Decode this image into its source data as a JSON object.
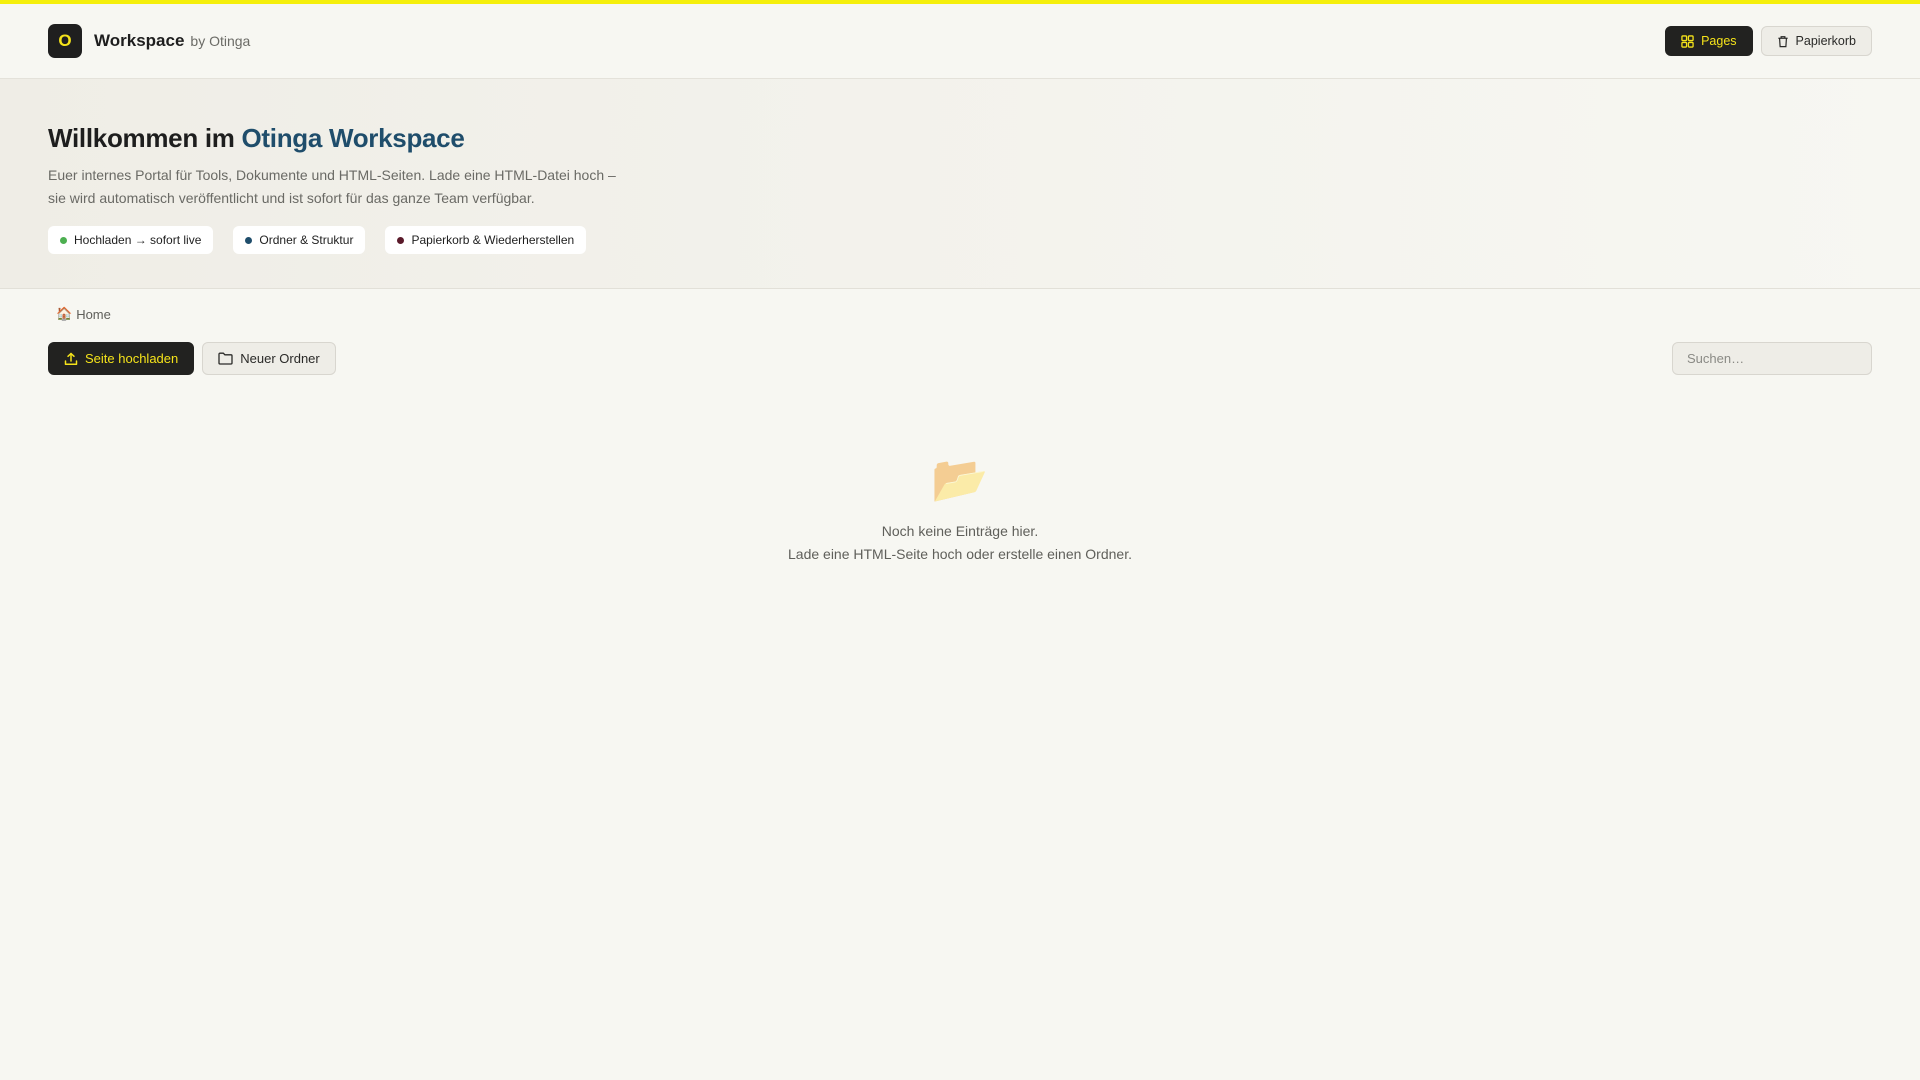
{
  "header": {
    "logo_letter": "O",
    "brand_name": "Workspace",
    "brand_by": "by Otinga",
    "nav": {
      "pages_label": "Pages",
      "trash_label": "Papierkorb"
    }
  },
  "hero": {
    "title_prefix": "Willkommen im ",
    "title_accent": "Otinga Workspace",
    "description_line1": "Euer internes Portal für Tools, Dokumente und HTML-Seiten. Lade eine HTML-Datei hoch –",
    "description_line2": "sie wird automatisch veröffentlicht und ist sofort für das ganze Team verfügbar.",
    "pills": [
      {
        "label": "Hochladen → sofort live",
        "color": "#4caf50"
      },
      {
        "label": "Ordner & Struktur",
        "color": "#1f4d6b"
      },
      {
        "label": "Papierkorb & Wiederherstellen",
        "color": "#5a1a2a"
      }
    ]
  },
  "breadcrumb": {
    "icon": "🏠",
    "label": "Home"
  },
  "toolbar": {
    "upload_label": "Seite hochladen",
    "new_folder_label": "Neuer Ordner",
    "search_placeholder": "Suchen…"
  },
  "empty_state": {
    "icon": "📂",
    "line1": "Noch keine Einträge hier.",
    "line2": "Lade eine HTML-Seite hoch oder erstelle einen Ordner."
  },
  "colors": {
    "accent_yellow": "#f5e31a",
    "accent_blue": "#1f4d6b",
    "dark": "#222220",
    "background": "#f7f7f2"
  }
}
